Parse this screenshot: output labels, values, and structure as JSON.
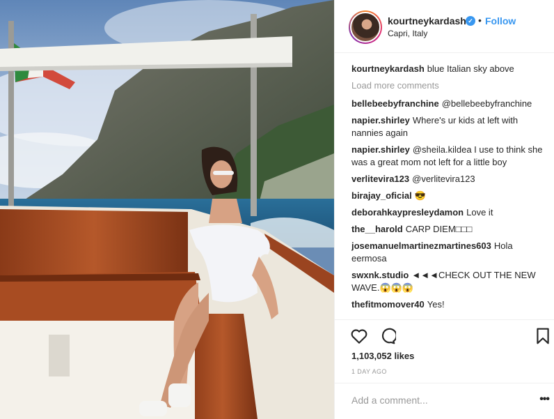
{
  "post": {
    "author": "kourtneykardash",
    "location": "Capri, Italy",
    "follow_label": "Follow",
    "dot": "•",
    "verified_mark": "✓"
  },
  "comments": {
    "caption": {
      "user": "kourtneykardash",
      "text": "blue Italian sky above"
    },
    "load_more": "Load more comments",
    "items": [
      {
        "user": "bellebeebyfranchine",
        "text": "@bellebeebyfranchine"
      },
      {
        "user": "napier.shirley",
        "text": "Where's ur kids at left with nannies again"
      },
      {
        "user": "napier.shirley",
        "text": "@sheila.kildea I use to think she was a great mom not left for a little boy"
      },
      {
        "user": "verlitevira123",
        "text": "@verlitevira123"
      },
      {
        "user": "birajay_oficial",
        "text": "😎"
      },
      {
        "user": "deborahkaypresleydamon",
        "text": "Love it"
      },
      {
        "user": "the__harold",
        "text": "CARP DIEM□□□"
      },
      {
        "user": "josemanuelmartinezmartines603",
        "text": "Hola eermosa"
      },
      {
        "user": "swxnk.studio",
        "text": "◄◄◄CHECK OUT THE NEW WAVE.😱😱😱"
      },
      {
        "user": "thefitmomover40",
        "text": "Yes!"
      }
    ]
  },
  "stats": {
    "likes": "1,103,052 likes",
    "time": "1 DAY AGO"
  },
  "add_comment": {
    "placeholder": "Add a comment...",
    "more": "•••"
  },
  "icons": {
    "like": "heart-icon",
    "comment": "comment-bubble-icon",
    "save": "bookmark-icon",
    "verified": "verified-badge-icon"
  },
  "colors": {
    "accent": "#3897f0",
    "text": "#262626",
    "muted": "#999999",
    "mention": "#003569"
  }
}
